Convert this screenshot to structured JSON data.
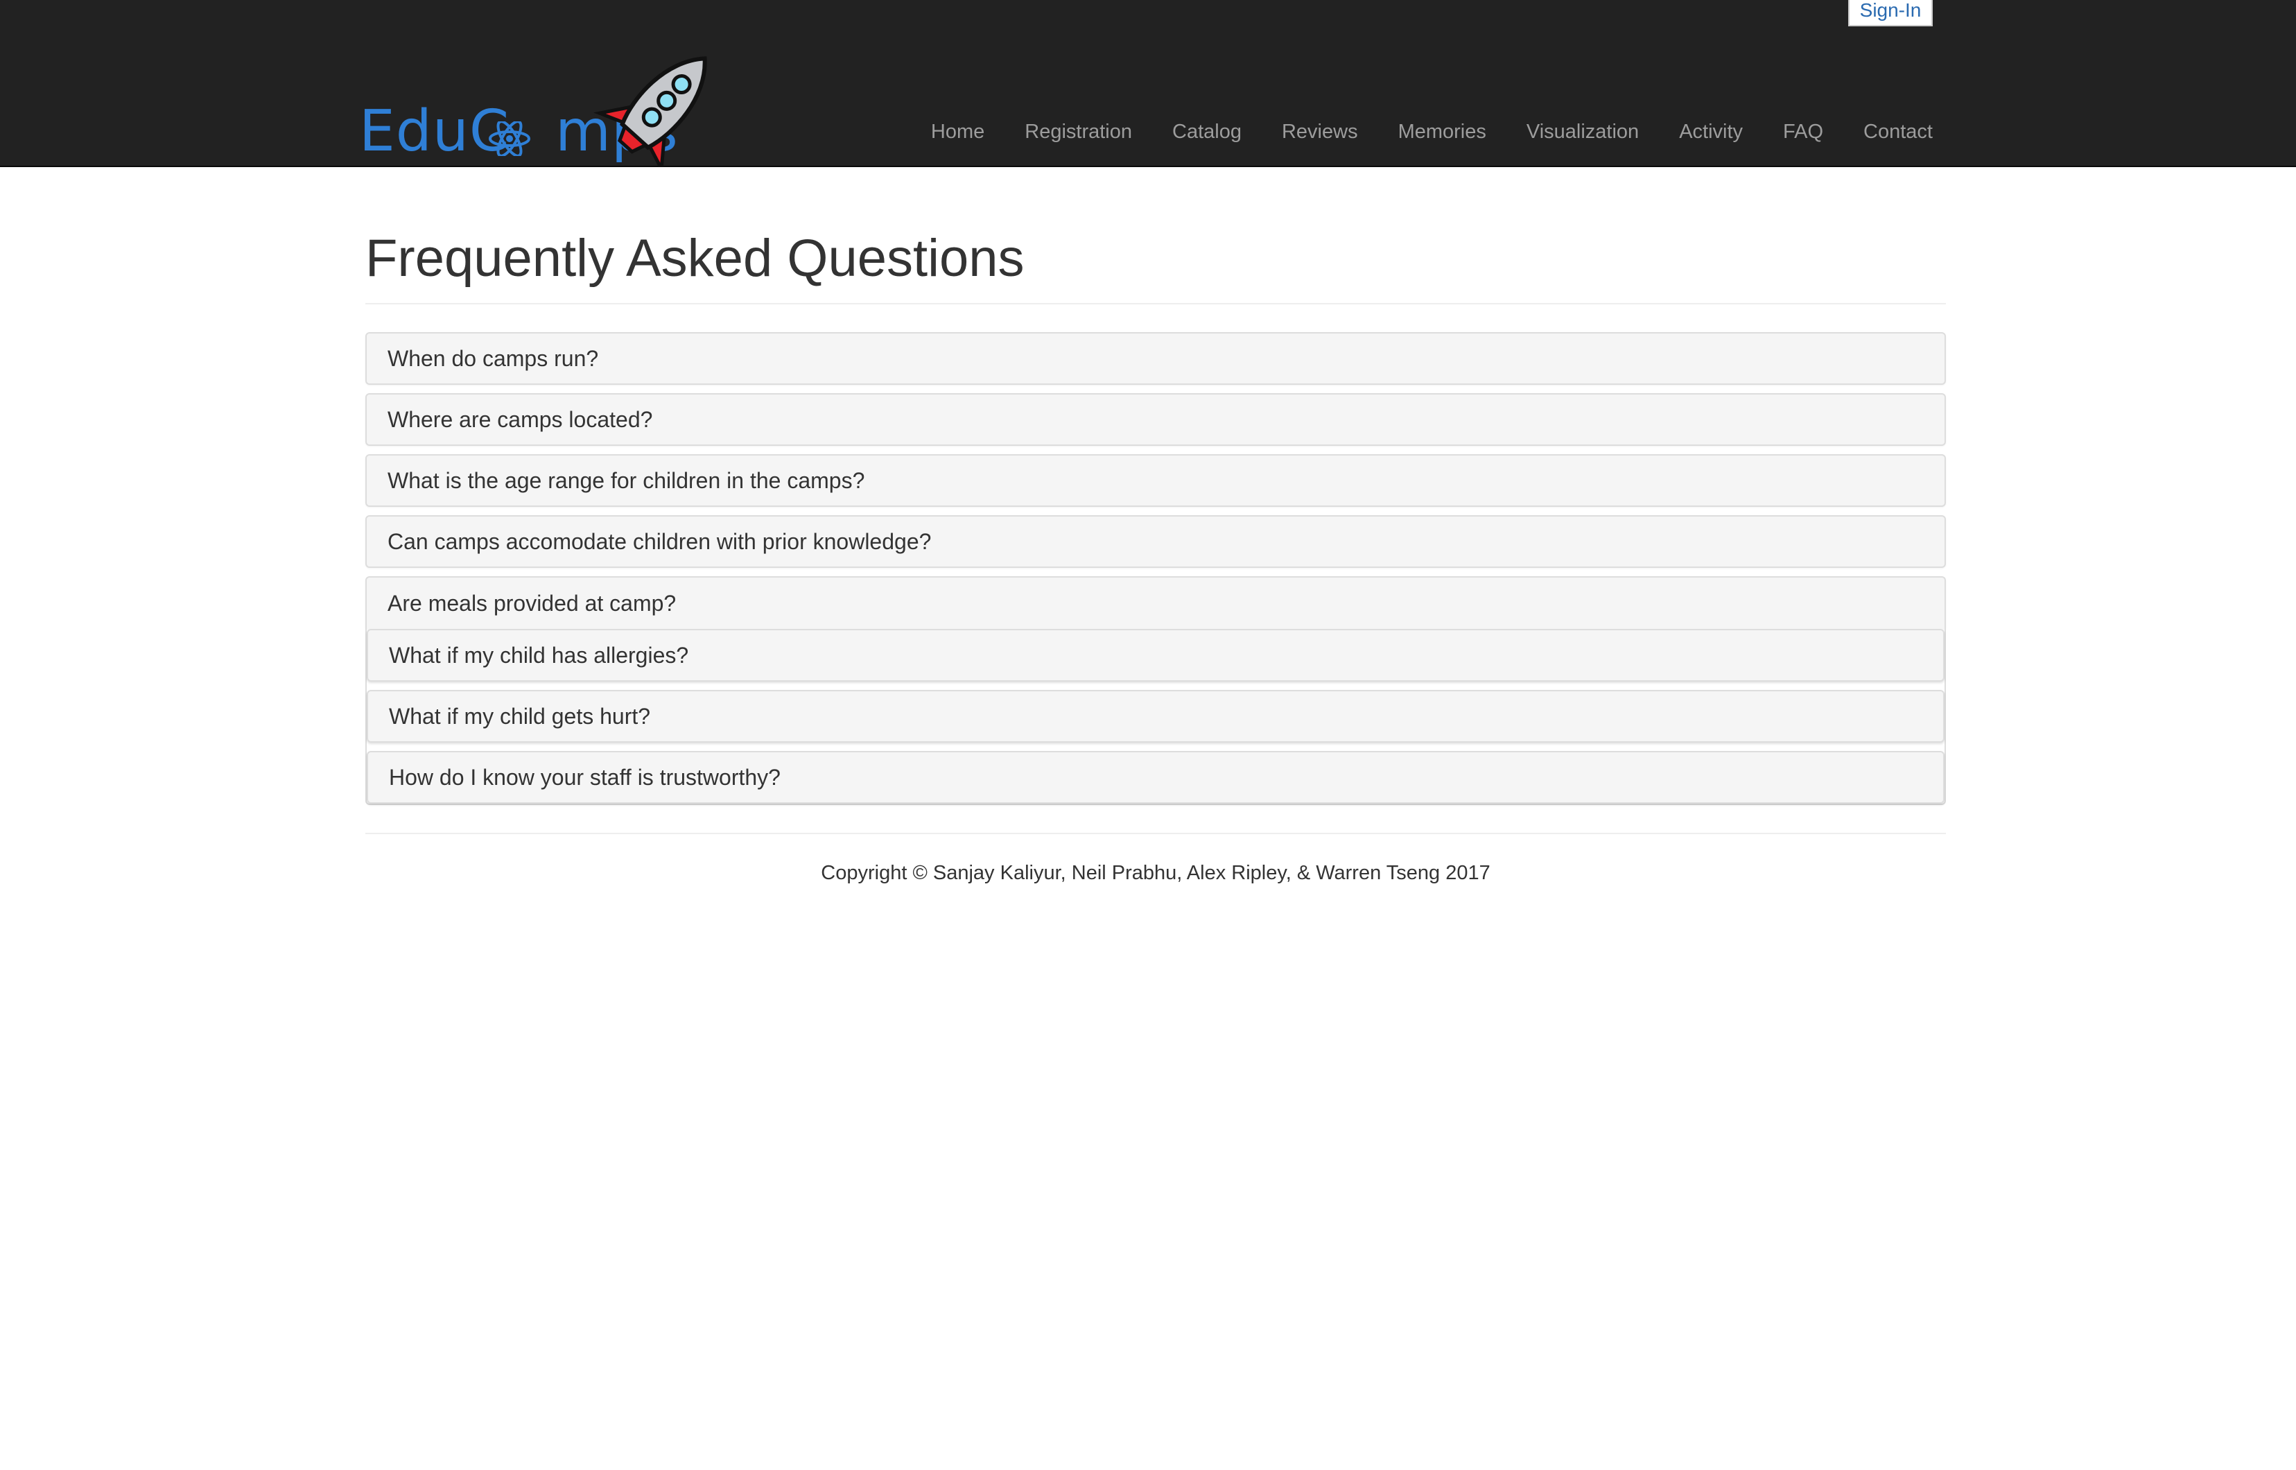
{
  "header": {
    "signin_label": "Sign-In",
    "brand": {
      "text_left": "EduC",
      "text_right": "mps",
      "accent_color": "#2f7fd6"
    },
    "nav": [
      {
        "label": "Home",
        "name": "nav-home"
      },
      {
        "label": "Registration",
        "name": "nav-registration"
      },
      {
        "label": "Catalog",
        "name": "nav-catalog"
      },
      {
        "label": "Reviews",
        "name": "nav-reviews"
      },
      {
        "label": "Memories",
        "name": "nav-memories"
      },
      {
        "label": "Visualization",
        "name": "nav-visualization"
      },
      {
        "label": "Activity",
        "name": "nav-activity"
      },
      {
        "label": "FAQ",
        "name": "nav-faq"
      },
      {
        "label": "Contact",
        "name": "nav-contact"
      }
    ]
  },
  "main": {
    "title": "Frequently Asked Questions",
    "faqs": [
      "When do camps run?",
      "Where are camps located?",
      "What is the age range for children in the camps?",
      "Can camps accomodate children with prior knowledge?",
      "Are meals provided at camp?",
      "What if my child has allergies?",
      "What if my child gets hurt?",
      "How do I know your staff is trustworthy?"
    ]
  },
  "footer": {
    "copyright": "Copyright © Sanjay Kaliyur, Neil Prabhu, Alex Ripley, & Warren Tseng 2017"
  },
  "colors": {
    "navbar_bg": "#222222",
    "nav_text": "#9d9d9d",
    "panel_bg": "#f5f5f5",
    "link": "#2a6ab0"
  }
}
